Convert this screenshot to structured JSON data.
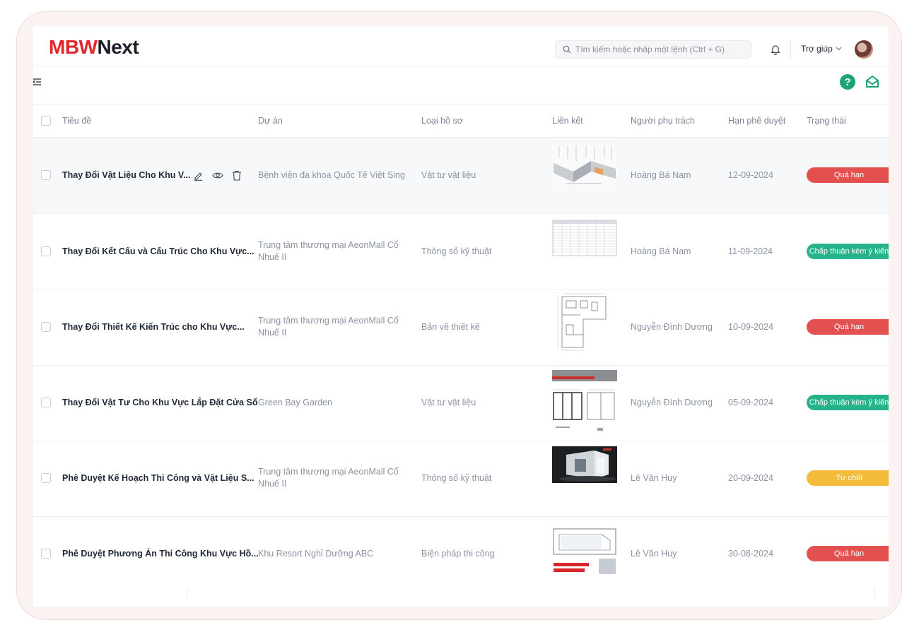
{
  "logo": {
    "brand": "MBW",
    "suffix": "Next"
  },
  "search": {
    "placeholder": "Tìm kiếm hoặc nhập một lệnh (Ctrl + G)"
  },
  "header": {
    "help_label": "Trợ giúp"
  },
  "icons": {
    "help": "?"
  },
  "table": {
    "columns": [
      "Tiêu đề",
      "Dự án",
      "Loại hồ sơ",
      "Liên kết",
      "Người phụ trách",
      "Hạn phê duyệt",
      "Trạng thái"
    ],
    "rows": [
      {
        "title": "Thay Đổi Vật Liệu Cho Khu V...",
        "project": "Bệnh viện đa khoa Quốc Tế Việt Sing",
        "type": "Vật tư vật liệu",
        "owner": "Hoàng Bá Nam",
        "deadline": "12-09-2024",
        "status": "Quá hạn",
        "status_color": "#e25050",
        "thumb": "ramp-3d"
      },
      {
        "title": "Thay Đổi Kết Cấu và Cấu Trúc Cho Khu Vực...",
        "project": "Trung tâm thương mại AeonMall Cổ Nhuế II",
        "type": "Thông số kỹ thuật",
        "owner": "Hoàng Bá Nam",
        "deadline": "11-09-2024",
        "status": "Chấp thuận kèm ý kiến",
        "status_color": "#26b28a",
        "thumb": "spreadsheet"
      },
      {
        "title": "Thay Đổi Thiết Kế Kiến Trúc cho Khu Vực...",
        "project": "Trung tâm thương mại AeonMall Cổ Nhuế II",
        "type": "Bản vẽ thiết kế",
        "owner": "Nguyễn Đình Dương",
        "deadline": "10-09-2024",
        "status": "Quá hạn",
        "status_color": "#e25050",
        "thumb": "floor-plan"
      },
      {
        "title": "Thay Đổi Vật Tư Cho Khu Vực Lắp Đặt Cửa Sổ",
        "project": "Green Bay Garden",
        "type": "Vật tư vật liệu",
        "owner": "Nguyễn Đình Dương",
        "deadline": "05-09-2024",
        "status": "Chấp thuận kèm ý kiến",
        "status_color": "#26b28a",
        "thumb": "window-drawing"
      },
      {
        "title": "Phê Duyệt Kế Hoạch Thi Công và Vật Liệu S...",
        "project": "Trung tâm thương mại AeonMall Cổ Nhuế II",
        "type": "Thông số kỹ thuật",
        "owner": "Lê Văn Huy",
        "deadline": "20-09-2024",
        "status": "Từ chối",
        "status_color": "#f2bc3a",
        "thumb": "booth-render"
      },
      {
        "title": "Phê Duyệt Phương Án Thi Công Khu Vực Hồ...",
        "project": "Khu Resort Nghỉ Dưỡng ABC",
        "type": "Biện pháp thi công",
        "owner": "Lê Văn Huy",
        "deadline": "30-08-2024",
        "status": "Quá hạn",
        "status_color": "#e25050",
        "thumb": "pool-drawing"
      }
    ]
  }
}
